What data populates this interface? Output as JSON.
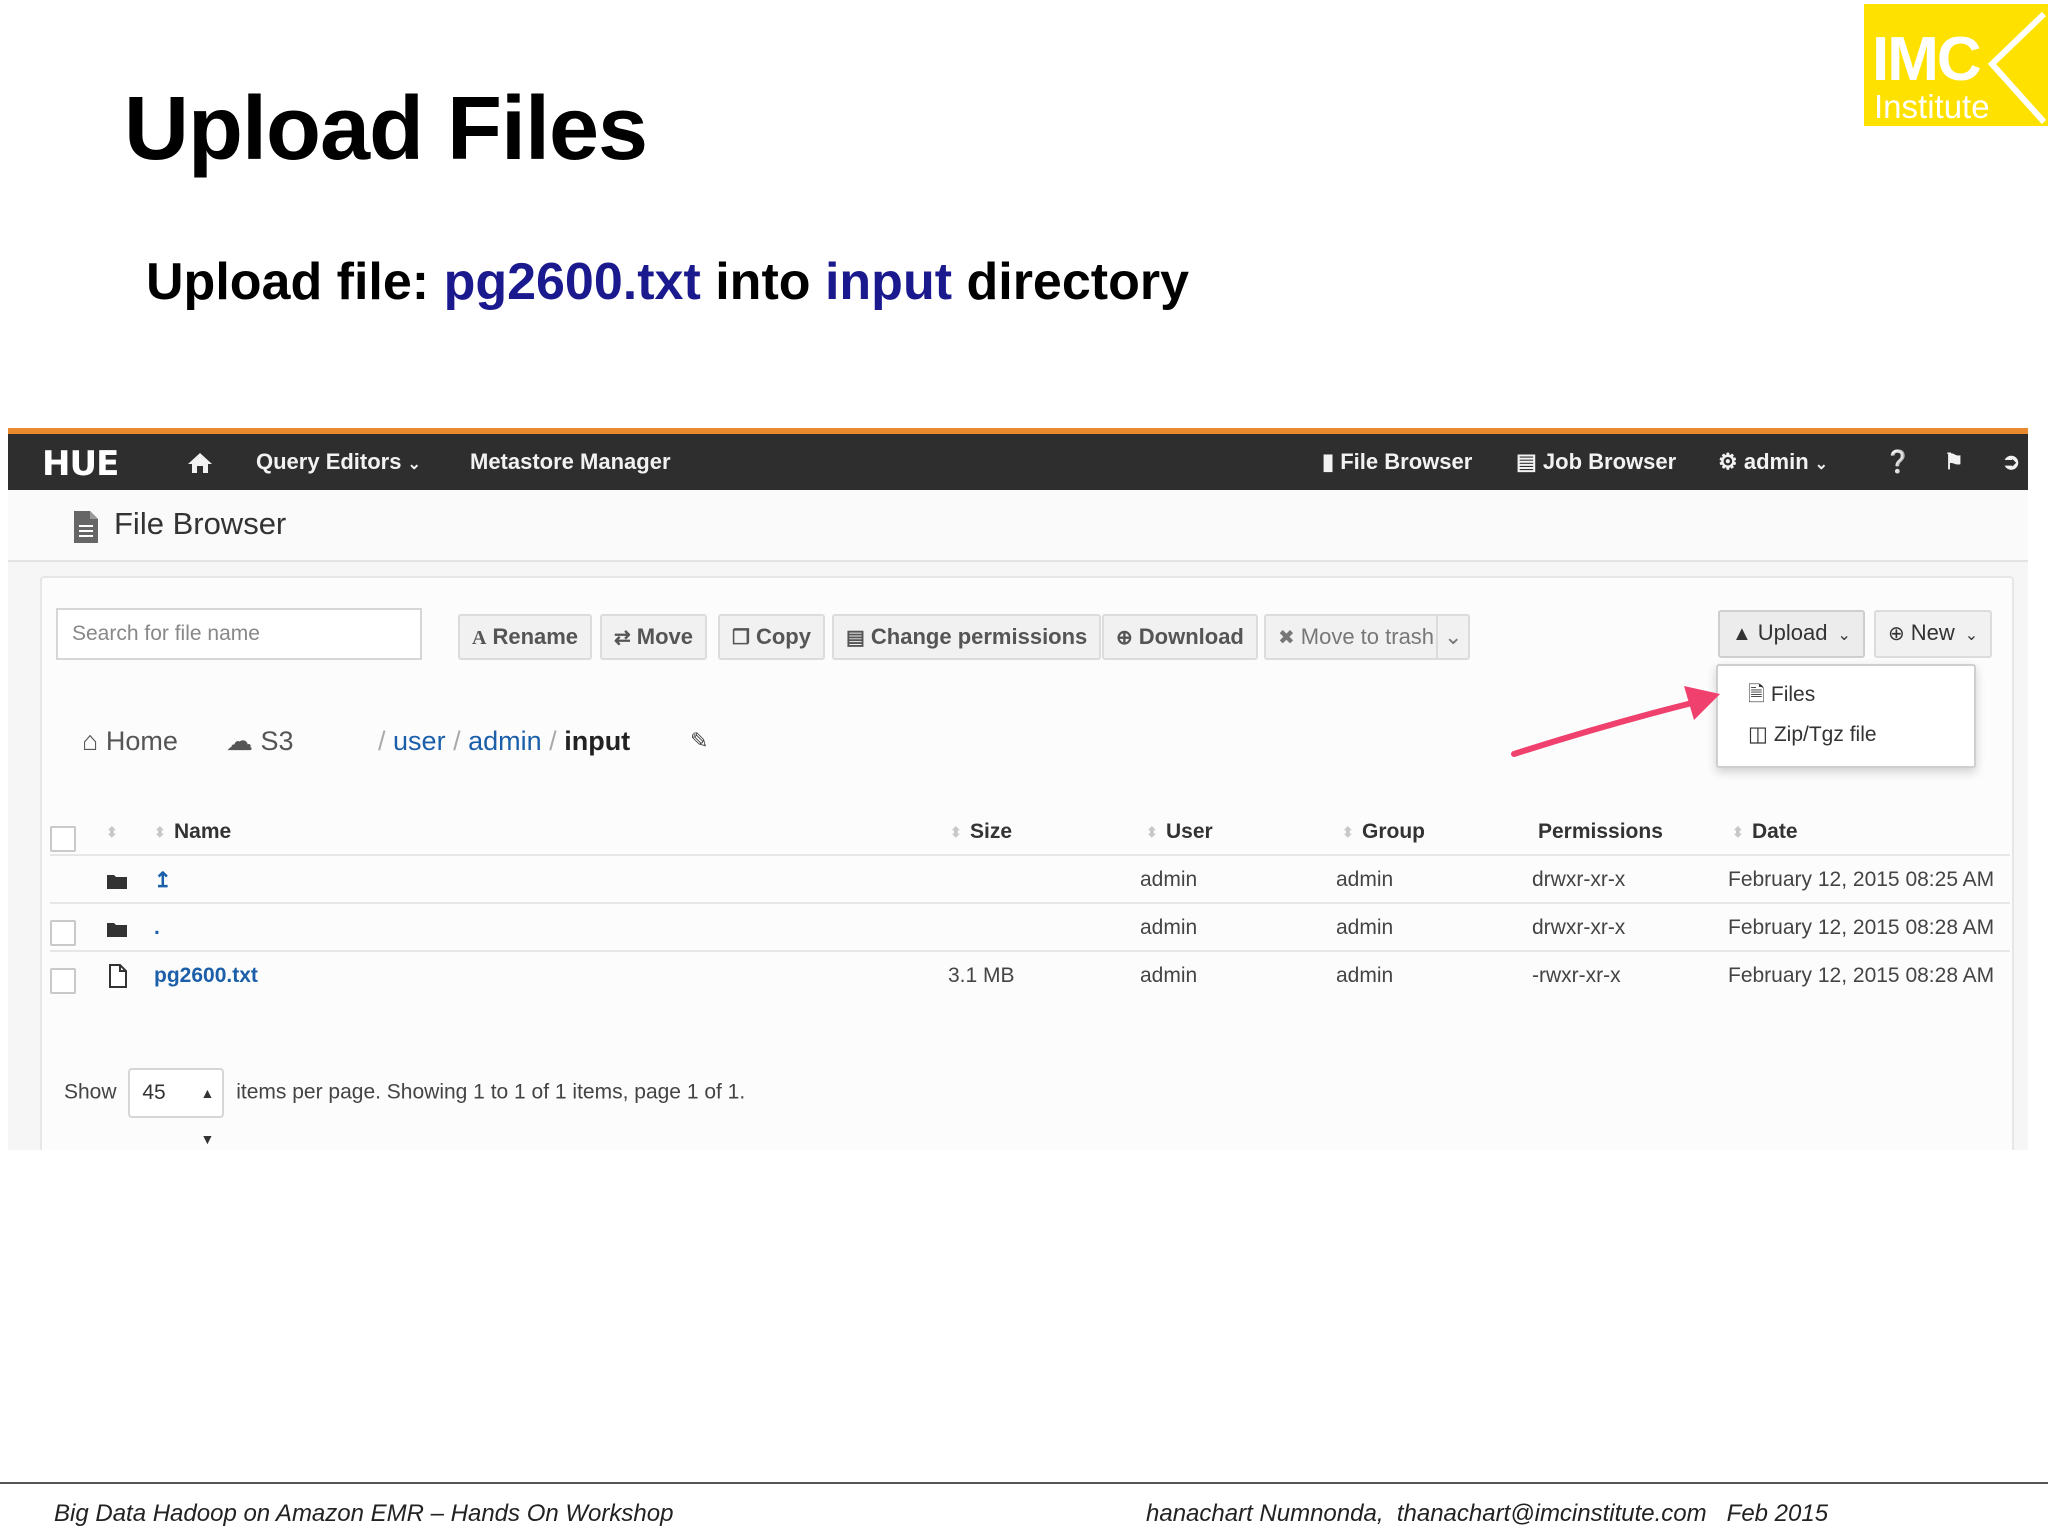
{
  "slide": {
    "title": "Upload Files",
    "subtitle_prefix": "Upload file: ",
    "subtitle_file": "pg2600.txt",
    "subtitle_mid": " into ",
    "subtitle_dir": "input",
    "subtitle_suffix": " directory",
    "logo_main": "IMC",
    "logo_sub": "Institute",
    "footer_left": "Big Data Hadoop on Amazon EMR – Hands On Workshop",
    "footer_right": "hanachart Numnonda,  thanachart@imcinstitute.com   Feb 2015"
  },
  "navbar": {
    "brand": "HUE",
    "query_editors": "Query Editors",
    "metastore": "Metastore Manager",
    "file_browser": "File Browser",
    "job_browser": "Job Browser",
    "user": "admin"
  },
  "page": {
    "title": "File Browser"
  },
  "toolbar": {
    "search_placeholder": "Search for file name",
    "rename": "Rename",
    "move": "Move",
    "copy": "Copy",
    "change_permissions": "Change permissions",
    "download": "Download",
    "move_to_trash": "Move to trash",
    "upload": "Upload",
    "new": "New"
  },
  "upload_menu": {
    "files": "Files",
    "zip": "Zip/Tgz file"
  },
  "breadcrumb": {
    "home": "Home",
    "s3": "S3",
    "sep": "/",
    "user": "user",
    "admin": "admin",
    "current": "input"
  },
  "table": {
    "headers": {
      "name": "Name",
      "size": "Size",
      "user": "User",
      "group": "Group",
      "permissions": "Permissions",
      "date": "Date"
    },
    "rows": [
      {
        "name": "↥",
        "size": "",
        "user": "admin",
        "group": "admin",
        "permissions": "drwxr-xr-x",
        "date": "February 12, 2015 08:25 AM"
      },
      {
        "name": ".",
        "size": "",
        "user": "admin",
        "group": "admin",
        "permissions": "drwxr-xr-x",
        "date": "February 12, 2015 08:28 AM"
      },
      {
        "name": "pg2600.txt",
        "size": "3.1 MB",
        "user": "admin",
        "group": "admin",
        "permissions": "-rwxr-xr-x",
        "date": "February 12, 2015 08:28 AM"
      }
    ]
  },
  "pagination": {
    "show": "Show",
    "per_page": "45",
    "summary": "items per page. Showing 1 to 1 of 1 items, page 1 of 1."
  },
  "colors": {
    "navbar": "#2e2e2e",
    "accent_orange": "#e88a2d",
    "link": "#1b5faa",
    "subtitle_highlight": "#1a1a8e",
    "logo_yellow": "#ffe100",
    "arrow": "#f0406e"
  }
}
